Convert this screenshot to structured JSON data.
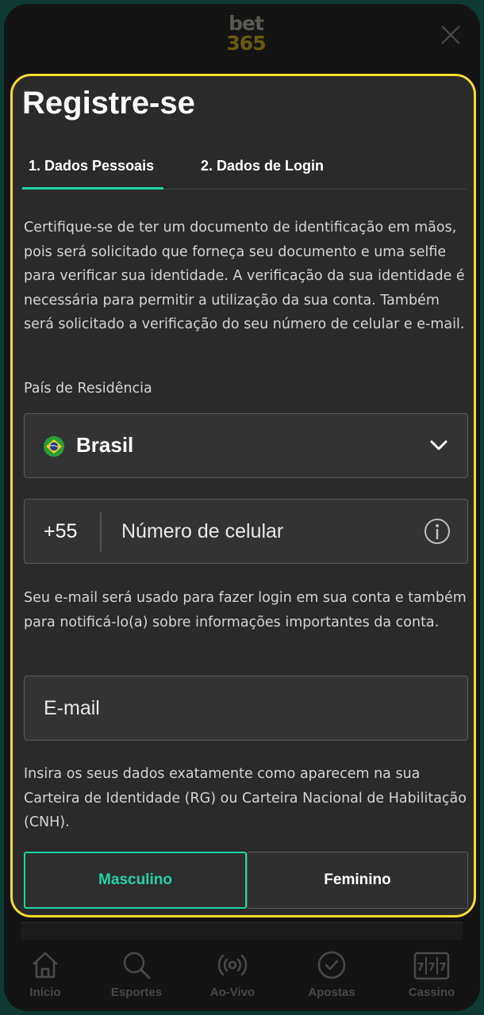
{
  "header": {
    "logo_line1": "bet",
    "logo_line2": "365"
  },
  "form": {
    "title": "Registre-se",
    "tabs": [
      {
        "label": "1.  Dados Pessoais"
      },
      {
        "label": "2.  Dados de Login"
      }
    ],
    "intro_text": "Certifique-se de ter um documento de identificação em mãos, pois será solicitado que forneça seu documento e uma selfie para verificar sua identidade. A verificação da sua identidade é necessária para permitir a utilização da sua conta. Também será solicitado a verificação do seu número de celular e e-mail.",
    "country_label": "País de Residência",
    "country_value": "Brasil",
    "phone_prefix": "+55",
    "phone_placeholder": "Número de celular",
    "email_note": "Seu e-mail será usado para fazer login em sua conta e também para notificá-lo(a) sobre informações importantes da conta.",
    "email_placeholder": "E-mail",
    "id_note": "Insira os seus dados exatamente como aparecem na sua Carteira de Identidade (RG) ou Carteira Nacional de Habilitação (CNH).",
    "gender_options": [
      "Masculino",
      "Feminino"
    ],
    "gender_selected": "Masculino"
  },
  "bottom_nav": [
    {
      "label": "Início",
      "icon": "home-icon"
    },
    {
      "label": "Esportes",
      "icon": "search-icon"
    },
    {
      "label": "Ao-Vivo",
      "icon": "live-broadcast-icon"
    },
    {
      "label": "Apostas",
      "icon": "check-circle-icon"
    },
    {
      "label": "Cassino",
      "icon": "slot-machine-icon"
    }
  ],
  "colors": {
    "accent": "#1fd4a4",
    "highlight_border": "#f5dc2c",
    "panel_bg": "#2a2a2a",
    "field_bg": "#333333"
  }
}
